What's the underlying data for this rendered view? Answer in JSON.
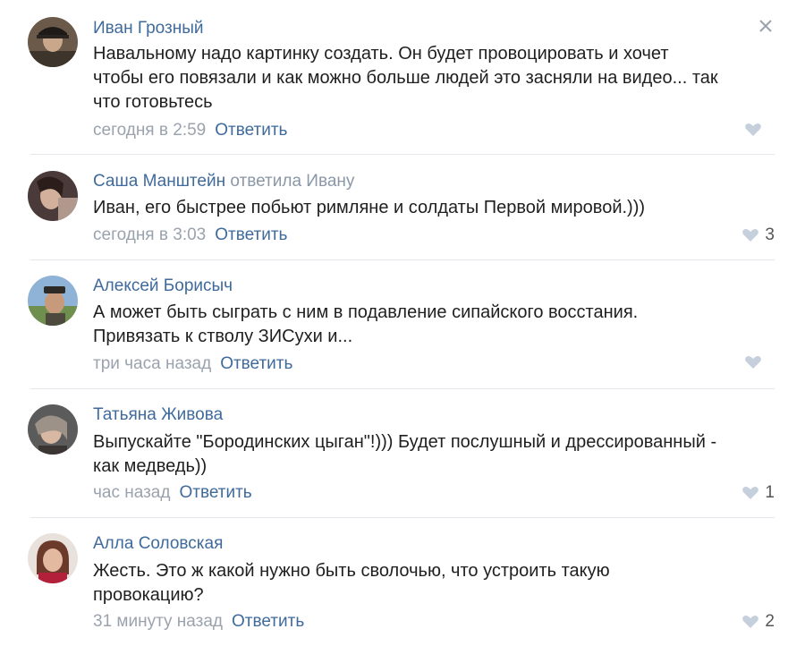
{
  "reply_label": "Ответить",
  "colors": {
    "author": "#3f6a9c",
    "meta": "#9aa3ad",
    "divider": "#e4e8ed"
  },
  "comments": [
    {
      "author": "Иван Грозный",
      "reply_to": "",
      "text": "Навальному надо картинку создать. Он будет провоцировать и хочет\nчтобы его повязали и как можно больше людей это засняли на видео... так\nчто готовьтесь",
      "time": "сегодня в 2:59",
      "likes": "",
      "avatar_icon": "avatar-ivan"
    },
    {
      "author": "Саша Манштейн",
      "reply_to": "ответила Ивану",
      "text": "Иван, его быстрее побьют римляне и солдаты Первой мировой.)))",
      "time": "сегодня в 3:03",
      "likes": "3",
      "avatar_icon": "avatar-sasha"
    },
    {
      "author": "Алексей Борисыч",
      "reply_to": "",
      "text": "А может быть сыграть с ним в подавление сипайского восстания.\nПривязать к стволу ЗИСухи и...",
      "time": "три часа назад",
      "likes": "",
      "avatar_icon": "avatar-aleksey"
    },
    {
      "author": "Татьяна Живова",
      "reply_to": "",
      "text": "Выпускайте \"Бородинских цыган\"!))) Будет послушный и дрессированный -\nкак медведь))",
      "time": "час назад",
      "likes": "1",
      "avatar_icon": "avatar-tatyana"
    },
    {
      "author": "Алла Соловская",
      "reply_to": "",
      "text": "Жесть. Это ж какой нужно быть сволочью, что устроить такую\nпровокацию?",
      "time": "31 минуту назад",
      "likes": "2",
      "avatar_icon": "avatar-alla"
    }
  ]
}
